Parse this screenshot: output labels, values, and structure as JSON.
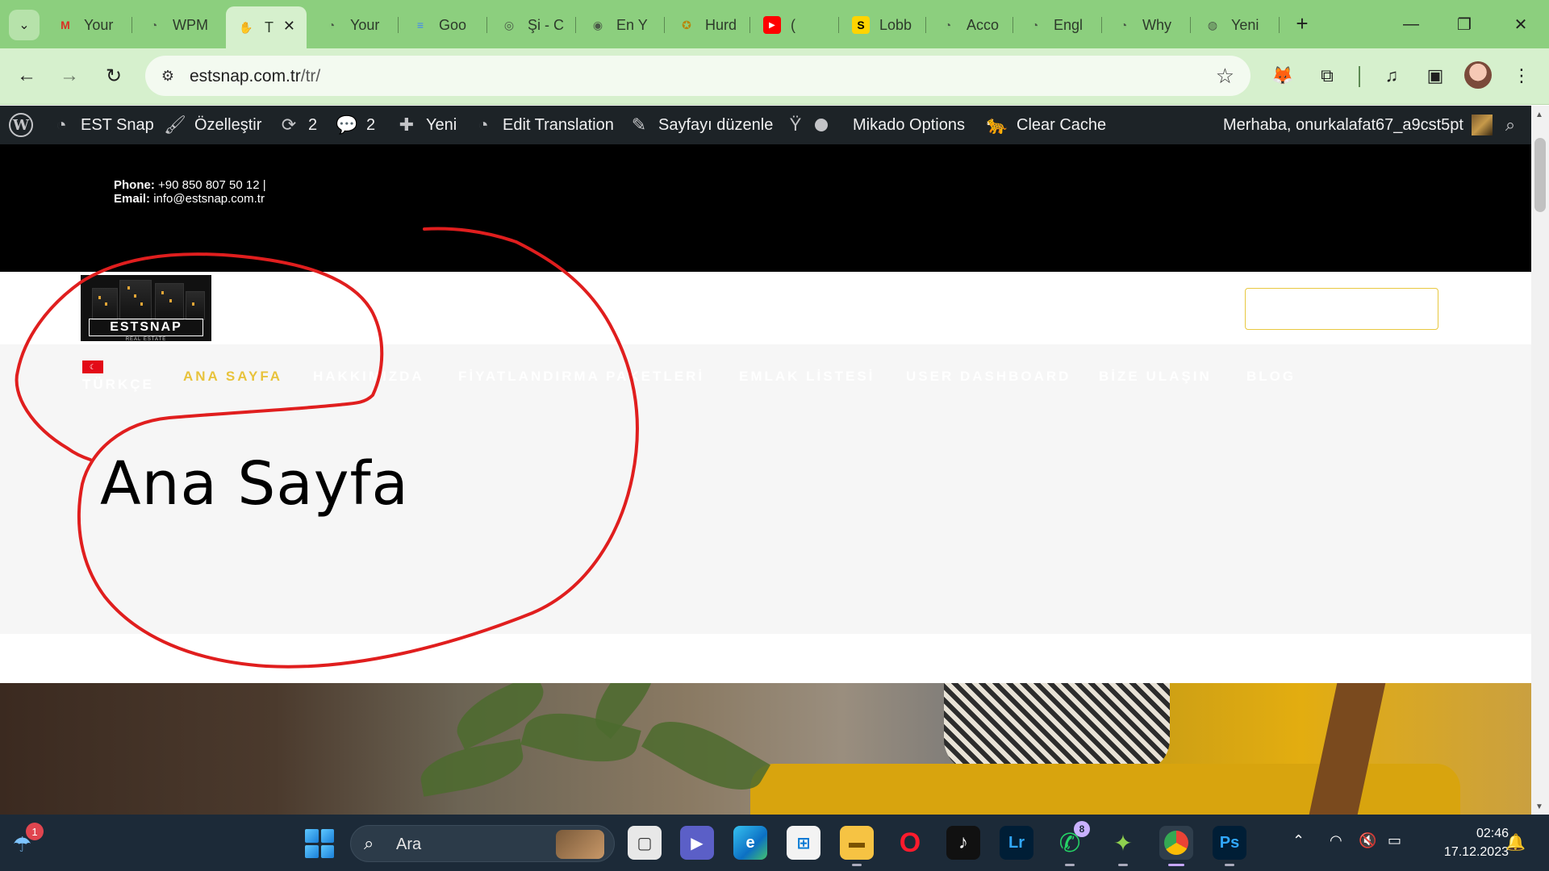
{
  "browser": {
    "tabs": [
      {
        "label": "Your",
        "icon": "gmail-icon",
        "icon_glyph": "M",
        "icon_color": "#d93025"
      },
      {
        "label": "WPM",
        "icon": "loading-icon",
        "icon_glyph": "◔",
        "icon_color": "#4a5a48"
      },
      {
        "label": "T",
        "icon": "hand-icon",
        "icon_glyph": "✋",
        "icon_color": "#222"
      },
      {
        "label": "Your",
        "icon": "loading-icon",
        "icon_glyph": "◔",
        "icon_color": "#4a5a48"
      },
      {
        "label": "Goo",
        "icon": "google-docs-icon",
        "icon_glyph": "≡",
        "icon_color": "#4285f4"
      },
      {
        "label": "Şi - C",
        "icon": "doc-circle-icon",
        "icon_glyph": "◎",
        "icon_color": "#4a5a48"
      },
      {
        "label": "En Y",
        "icon": "gear-circle-icon",
        "icon_glyph": "◉",
        "icon_color": "#4a5a48"
      },
      {
        "label": "Hurd",
        "icon": "coin-icon",
        "icon_glyph": "✪",
        "icon_color": "#b8860b"
      },
      {
        "label": "(",
        "icon": "youtube-icon",
        "icon_glyph": "▶",
        "icon_color": "#ff0000"
      },
      {
        "label": "Lobb",
        "icon": "s-logo-icon",
        "icon_glyph": "S",
        "icon_color": "#000"
      },
      {
        "label": "Acco",
        "icon": "loading-icon",
        "icon_glyph": "◔",
        "icon_color": "#4a5a48"
      },
      {
        "label": "Engl",
        "icon": "loading-icon",
        "icon_glyph": "◔",
        "icon_color": "#4a5a48"
      },
      {
        "label": "Why",
        "icon": "loading-icon",
        "icon_glyph": "◔",
        "icon_color": "#4a5a48"
      },
      {
        "label": "Yeni",
        "icon": "chrome-icon",
        "icon_glyph": "◍",
        "icon_color": "#4a5a48"
      }
    ],
    "active_tab_index": 2,
    "url_host": "estsnap.com.tr",
    "url_path": "/tr/"
  },
  "adminbar": {
    "site_name": "EST Snap",
    "customize": "Özelleştir",
    "updates_count": "2",
    "comments_count": "2",
    "new": "Yeni",
    "edit_translation": "Edit Translation",
    "edit_page": "Sayfayı düzenle",
    "mikado": "Mikado Options",
    "clear_cache": "Clear Cache",
    "greeting": "Merhaba, onurkalafat67_a9cst5pt"
  },
  "site": {
    "phone_label": "Phone:",
    "phone_value": "+90 850 807 50 12 |",
    "email_label": "Email:",
    "email_value": "info@estsnap.com.tr",
    "logo_text": "ESTSNAP",
    "logo_sub": "REAL ESTATE",
    "language": "TÜRKÇE",
    "menu": [
      "ANA SAYFA",
      "HAKKIMIZDA",
      "FİYATLANDIRMA PAKETLERİ",
      "EMLAK LİSTESİ",
      "USER DASHBOARD",
      "BİZE ULAŞIN",
      "BLOG"
    ],
    "active_menu_index": 0,
    "page_title": "Ana Sayfa",
    "accent_color": "#e8c33c"
  },
  "annotation": {
    "color": "#e01e1e"
  },
  "taskbar": {
    "weather_badge": "1",
    "search_placeholder": "Ara",
    "whatsapp_badge": "8",
    "lr_label": "Lr",
    "ps_label": "Ps",
    "time": "02:46",
    "date": "17.12.2023"
  }
}
